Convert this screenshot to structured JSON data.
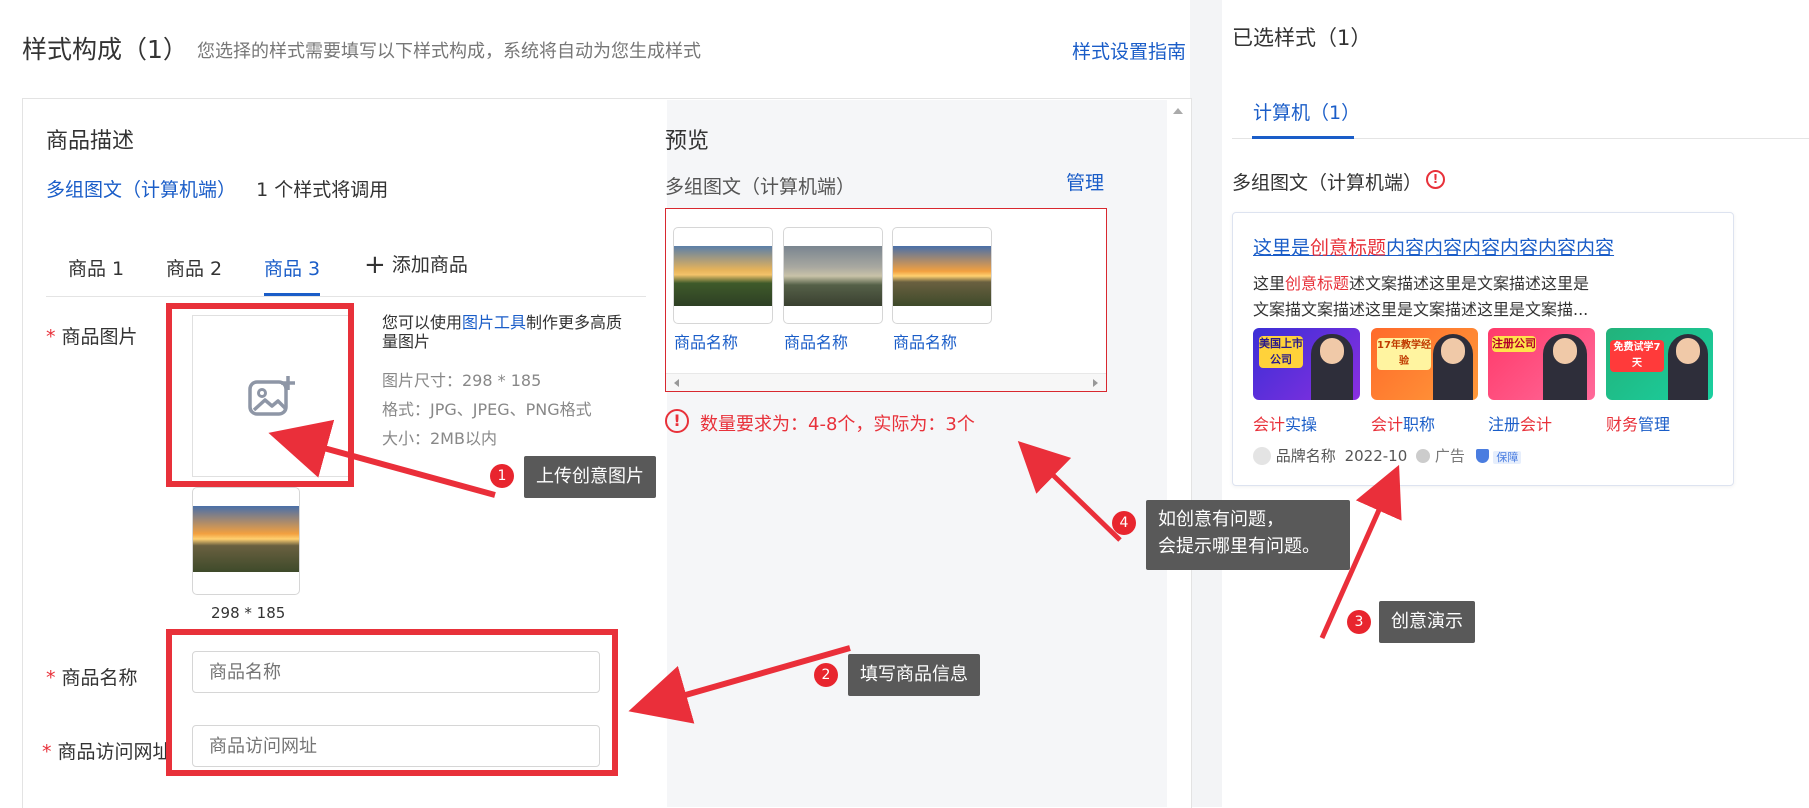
{
  "header": {
    "title": "样式构成（1）",
    "subtitle": "您选择的样式需要填写以下样式构成，系统将自动为您生成样式",
    "guide_link": "样式设置指南"
  },
  "form": {
    "section_title": "商品描述",
    "style_link": "多组图文（计算机端）",
    "style_note": "1 个样式将调用",
    "tabs": [
      {
        "label": "商品 1",
        "active": false
      },
      {
        "label": "商品 2",
        "active": false
      },
      {
        "label": "商品 3",
        "active": true
      }
    ],
    "add_tab": "添加商品",
    "image_label": "商品图片",
    "image_hint_prefix": "您可以使用",
    "image_hint_link": "图片工具",
    "image_hint_suffix": "制作更多高质量图片",
    "image_size": "图片尺寸：298 * 185",
    "image_format": "格式：JPG、JPEG、PNG格式",
    "image_maxsize": "大小：2MB以内",
    "thumb_caption": "298 * 185",
    "name_label": "商品名称",
    "name_placeholder": "商品名称",
    "url_label": "商品访问网址",
    "url_placeholder": "商品访问网址",
    "required_mark": "*"
  },
  "preview": {
    "title": "预览",
    "style_name": "多组图文（计算机端）",
    "manage_link": "管理",
    "items": [
      "商品名称",
      "商品名称",
      "商品名称"
    ],
    "error": "数量要求为：4-8个，实际为：3个"
  },
  "selected": {
    "title": "已选样式（1）",
    "tab": "计算机（1）",
    "style_name": "多组图文（计算机端）",
    "ad": {
      "title_prefix": "这里是",
      "title_highlight": "创意标题",
      "title_suffix": "内容内容内容内容内容内容",
      "desc_line1_prefix": "这里",
      "desc_line1_highlight": "创意标题",
      "desc_line1_suffix": "述文案描述这里是文案描述这里是",
      "desc_line2": "文案描文案描述这里是文案描述这里是文案描...",
      "images": [
        {
          "text": "美国上市公司",
          "bg1": "#3b2fd6",
          "bg2": "#8b2fe0"
        },
        {
          "text": "17年教学经验",
          "bg1": "#ff6a2a",
          "bg2": "#ff9a3a"
        },
        {
          "text": "注册公司",
          "bg1": "#ff3a6a",
          "bg2": "#ff6a9a"
        },
        {
          "text": "免费试学7天",
          "bg1": "#22b27a",
          "bg2": "#1ad0a0"
        }
      ],
      "links": [
        {
          "prefix": "会计",
          "suffix": "实操"
        },
        {
          "prefix": "会计",
          "suffix": "职称"
        },
        {
          "prefix": "注册",
          "suffix": "会计"
        },
        {
          "prefix": "财务",
          "suffix": "管理"
        }
      ],
      "brand": "品牌名称",
      "date": "2022-10",
      "ad_tag": "广告",
      "guarantee": "保障"
    }
  },
  "annotations": [
    {
      "num": "1",
      "text": "上传创意图片"
    },
    {
      "num": "2",
      "text": "填写商品信息"
    },
    {
      "num": "3",
      "text": "创意演示"
    },
    {
      "num": "4",
      "line1": "如创意有问题，",
      "line2": "会提示哪里有问题。"
    }
  ],
  "colors": {
    "accent": "#1a5dc8",
    "error": "#e8313a",
    "highlight": "#e8313a"
  }
}
